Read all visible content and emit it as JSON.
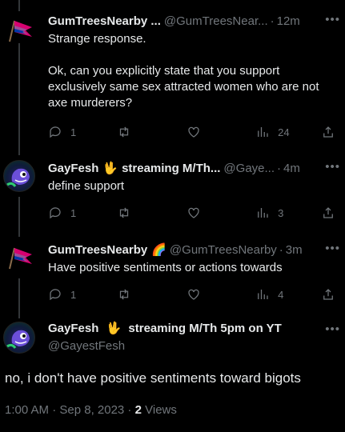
{
  "tweets": [
    {
      "name": "GumTreesNearby ...",
      "handle": "@GumTreesNear...",
      "time": "12m",
      "text": "Strange response.\n\nOk, can you explicitly state that you support exclusively same sex attracted women who are not axe murderers?",
      "replies": "1",
      "views": "24"
    },
    {
      "name": "GayFesh",
      "emoji": "🖖",
      "name_suffix": "streaming M/Th...",
      "handle": "@Gaye...",
      "time": "4m",
      "text": "define support",
      "replies": "1",
      "views": "3"
    },
    {
      "name": "GumTreesNearby",
      "emoji": "🌈",
      "handle": "@GumTreesNearby",
      "time": "3m",
      "text": "Have positive sentiments or actions towards",
      "replies": "1",
      "views": "4"
    }
  ],
  "main": {
    "name": "GayFesh",
    "emoji": "🖖",
    "name_suffix": "streaming M/Th 5pm on YT",
    "handle": "@GayestFesh",
    "text": "no, i don't have positive sentiments toward bigots",
    "timestamp": "1:00 AM · Sep 8, 2023 ·",
    "views_count": "2",
    "views_label": "Views"
  },
  "icons": [
    "more-icon",
    "reply-icon",
    "retweet-icon",
    "like-icon",
    "views-icon",
    "share-icon"
  ],
  "colors": {
    "background": "#000000",
    "text": "#e7e9ea",
    "muted": "#71767b"
  }
}
